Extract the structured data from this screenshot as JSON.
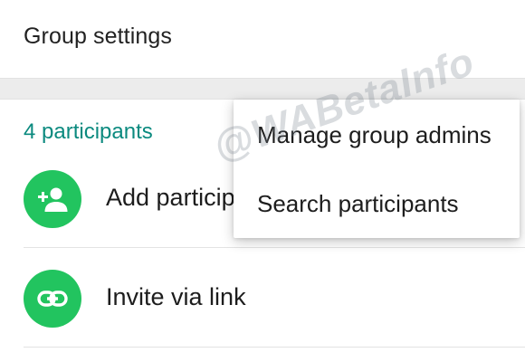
{
  "settings": {
    "group_settings_label": "Group settings"
  },
  "participants": {
    "count_label": "4 participants"
  },
  "actions": [
    {
      "label": "Add participants",
      "icon": "add-person-icon"
    },
    {
      "label": "Invite via link",
      "icon": "link-icon"
    }
  ],
  "menu": {
    "items": [
      {
        "label": "Manage group admins"
      },
      {
        "label": "Search participants"
      }
    ]
  },
  "watermark": "@WABetaInfo",
  "colors": {
    "accent_teal": "#0b8a7f",
    "icon_green": "#22c45f"
  }
}
